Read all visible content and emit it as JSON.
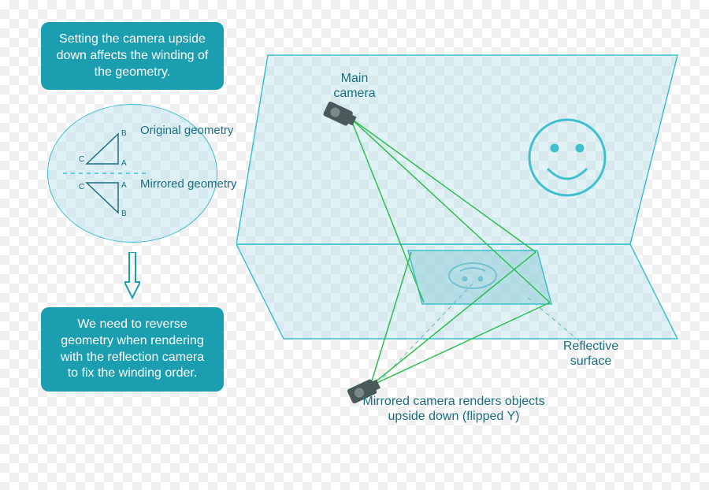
{
  "colors": {
    "teal": "#1b9eaf",
    "tealText": "#1b6e80",
    "lightTeal": "rgba(180,225,235,0.45)",
    "paneFill": "rgba(170,220,230,0.35)",
    "paneStroke": "#3fbfcf",
    "ray": "#2fbf4f",
    "dashed": "#6fbfcf"
  },
  "callouts": {
    "top": "Setting the camera upside down  affects the winding of the geometry.",
    "bottom": "We need to reverse geometry when rendering with the reflection camera to fix the winding order."
  },
  "geometry": {
    "original_label": "Original geometry",
    "mirrored_label": "Mirrored geometry",
    "vertex_a": "A",
    "vertex_b": "B",
    "vertex_c": "C"
  },
  "scene": {
    "main_camera_label": "Main camera",
    "mirrored_camera_label": "Mirrored camera renders objects upside down (flipped Y)",
    "reflective_surface_label": "Reflective surface"
  },
  "icons": {
    "camera": "camera-icon",
    "smile": "smile-icon",
    "arrow_down": "arrow-down-icon"
  }
}
